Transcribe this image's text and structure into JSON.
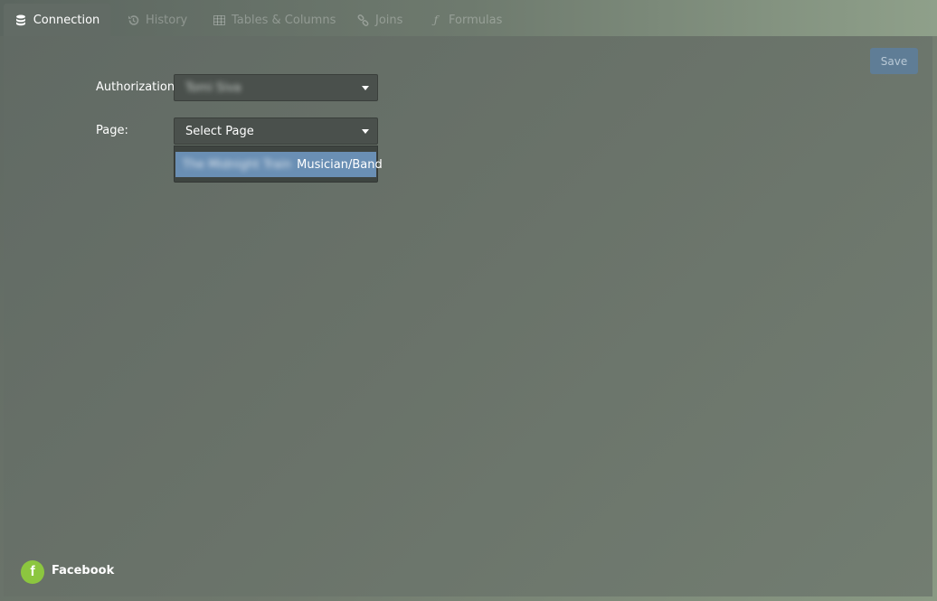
{
  "tabs": [
    {
      "label": "Connection",
      "icon": "database-icon",
      "active": true
    },
    {
      "label": "History",
      "icon": "history-icon"
    },
    {
      "label": "Tables & Columns",
      "icon": "table-icon"
    },
    {
      "label": "Joins",
      "icon": "link-icon"
    },
    {
      "label": "Formulas",
      "icon": "function-icon"
    }
  ],
  "toolbar": {
    "save_label": "Save"
  },
  "form": {
    "authorization_label": "Authorization:",
    "authorization_value": "Tomi Siva",
    "page_label": "Page:",
    "page_placeholder": "Select Page",
    "page_options": [
      {
        "name": "The Midnight Train",
        "category": "Musician/Band"
      }
    ]
  },
  "footer": {
    "connector_label": "Facebook",
    "icon_glyph": "f"
  },
  "colors": {
    "accent": "#6a8fb4",
    "save_button": "#5f7d96",
    "facebook_icon": "#8cc63f"
  }
}
